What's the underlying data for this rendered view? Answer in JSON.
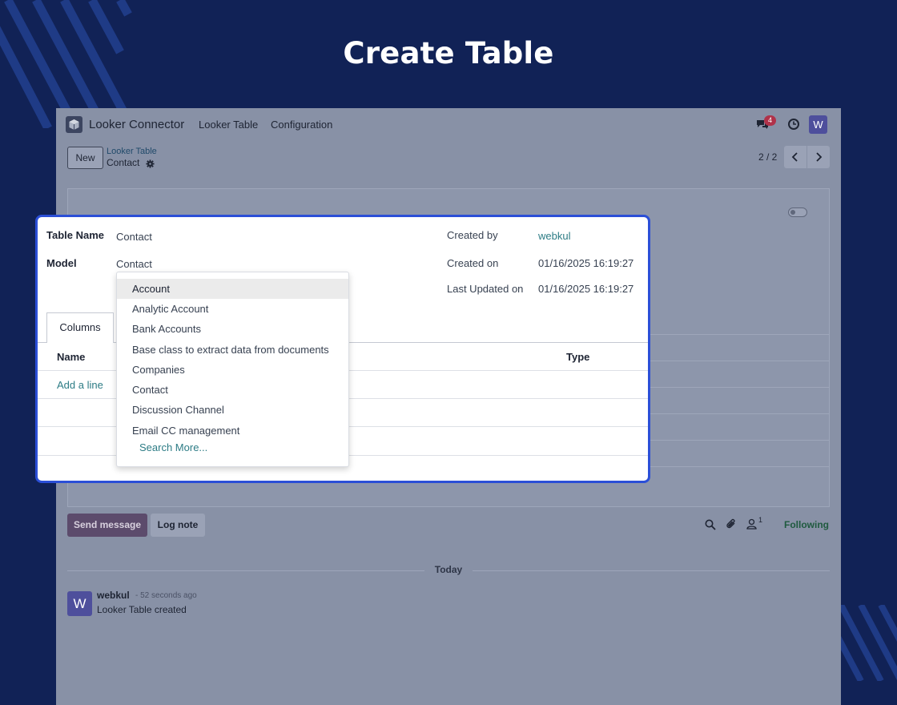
{
  "banner": {
    "title": "Create Table"
  },
  "navbar": {
    "app_name": "Looker Connector",
    "menu": [
      "Looker Table",
      "Configuration"
    ],
    "chat_badge": "4",
    "avatar_letter": "W"
  },
  "control": {
    "new_label": "New",
    "breadcrumb_parent": "Looker Table",
    "breadcrumb_current": "Contact",
    "pager": "2 / 2"
  },
  "form": {
    "table_name_label": "Table Name",
    "table_name_value": "Contact",
    "model_label": "Model",
    "model_value": "Contact",
    "created_by_label": "Created by",
    "created_by_value": "webkul",
    "created_on_label": "Created on",
    "created_on_value": "01/16/2025 16:19:27",
    "last_updated_label": "Last Updated on",
    "last_updated_value": "01/16/2025 16:19:27",
    "tab_columns": "Columns",
    "col_name": "Name",
    "col_type": "Type",
    "add_line": "Add a line"
  },
  "dropdown": {
    "items": [
      "Account",
      "Analytic Account",
      "Bank Accounts",
      "Base class to extract data from documents",
      "Companies",
      "Contact",
      "Discussion Channel",
      "Email CC management"
    ],
    "active_index": 0,
    "search_more": "Search More..."
  },
  "chatter": {
    "send_message": "Send message",
    "log_note": "Log note",
    "follower_count": "1",
    "following": "Following",
    "today": "Today",
    "message": {
      "avatar_letter": "W",
      "author": "webkul",
      "time": "- 52 seconds ago",
      "body": "Looker Table created"
    }
  },
  "colors": {
    "page_background": "#112256",
    "highlight_border": "#2b4fd7",
    "link": "#2d7c85",
    "avatar": "#4e4f9c",
    "badge": "#b0324a"
  }
}
